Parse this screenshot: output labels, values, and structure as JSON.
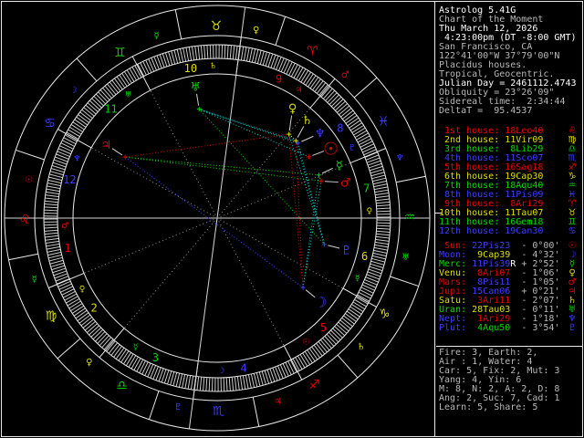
{
  "app": {
    "title": "Astrolog 5.41G"
  },
  "palette": {
    "red": "#e00000",
    "yellow": "#dede00",
    "green": "#00d400",
    "blue": "#3c3cff",
    "cyan": "#00d4d4",
    "gray": "#b8b8b8",
    "white": "#ffffff",
    "dim_gray": "#8f8f8f",
    "line_white": "#e9e9e9",
    "axis_gray": "#d6d6d6",
    "tick_gray": "#c9c9c9",
    "pointer_gray": "#cfcfcf"
  },
  "sidebar": {
    "header": [
      {
        "text": "Astrolog 5.41G",
        "bright": true
      },
      {
        "text": "Chart of the Moment",
        "bright": false
      },
      {
        "text": "Thu March 12, 2026",
        "bright": true
      },
      {
        "text": " 4:23:00pm (DT -8:00 GMT)",
        "bright": true
      },
      {
        "text": "San Francisco, CA",
        "bright": false
      },
      {
        "text": "122°41'00\"W 37°79'00\"N",
        "bright": false
      },
      {
        "text": "Placidus houses.",
        "bright": false
      },
      {
        "text": "Tropical, Geocentric.",
        "bright": false
      },
      {
        "text": "Julian Day = 2461112.4743",
        "bright": true
      },
      {
        "text": "Obliquity = 23°26'09\"",
        "bright": false
      },
      {
        "text": "Sidereal time:  2:34:44",
        "bright": false
      },
      {
        "text": "DeltaT =  95.4537",
        "bright": false
      }
    ],
    "houses": [
      {
        "ord": "1st",
        "pos": "18Leo40",
        "sign": "Leo"
      },
      {
        "ord": "2nd",
        "pos": "11Vir09",
        "sign": "Virgo"
      },
      {
        "ord": "3rd",
        "pos": "8Lib29",
        "sign": "Libra"
      },
      {
        "ord": "4th",
        "pos": "11Sco07",
        "sign": "Scorpio"
      },
      {
        "ord": "5th",
        "pos": "16Sag18",
        "sign": "Sagittarius"
      },
      {
        "ord": "6th",
        "pos": "19Cap30",
        "sign": "Capricorn"
      },
      {
        "ord": "7th",
        "pos": "18Aqu40",
        "sign": "Aquarius"
      },
      {
        "ord": "8th",
        "pos": "11Pis09",
        "sign": "Pisces"
      },
      {
        "ord": "9th",
        "pos": "8Ari29",
        "sign": "Aries"
      },
      {
        "ord": "10th",
        "pos": "11Tau07",
        "sign": "Taurus"
      },
      {
        "ord": "11th",
        "pos": "16Gem18",
        "sign": "Gemini"
      },
      {
        "ord": "12th",
        "pos": "19Can30",
        "sign": "Cancer"
      }
    ],
    "planets": [
      {
        "name": "Sun",
        "pos": "22Pis23",
        "retro": false,
        "vel": "- 0°00'"
      },
      {
        "name": "Moon",
        "pos": "9Cap39",
        "retro": false,
        "vel": "- 4°32'"
      },
      {
        "name": "Merc",
        "pos": "11Pis39",
        "retro": true,
        "vel": "+ 2°52'"
      },
      {
        "name": "Venu",
        "pos": "8Ari07",
        "retro": false,
        "vel": "- 1°06'"
      },
      {
        "name": "Mars",
        "pos": "8Pis11",
        "retro": false,
        "vel": "- 1°05'"
      },
      {
        "name": "Jupi",
        "pos": "15Can06",
        "retro": false,
        "vel": "+ 0°21'"
      },
      {
        "name": "Satu",
        "pos": "3Ari11",
        "retro": false,
        "vel": "- 2°07'"
      },
      {
        "name": "Uran",
        "pos": "28Tau03",
        "retro": false,
        "vel": "- 0°11'"
      },
      {
        "name": "Nept",
        "pos": "1Ari29",
        "retro": false,
        "vel": "- 1°18'"
      },
      {
        "name": "Plut",
        "pos": "4Aqu50",
        "retro": false,
        "vel": "- 3°54'"
      }
    ],
    "stats": [
      "Fire: 3, Earth: 2,",
      "Air : 1, Water: 4",
      "Car: 5, Fix: 2, Mut: 3",
      "Yang: 4, Yin: 6",
      "M: 8, N: 2, A: 2, D: 8",
      "Ang: 2, Suc: 7, Cad: 1",
      "Learn: 5, Share: 5"
    ]
  },
  "chart_data": {
    "type": "astrology_wheel",
    "title": "Chart of the Moment",
    "center": [
      238,
      239
    ],
    "radii": {
      "outer": 233,
      "sign_inner": 200,
      "band_outer": 190,
      "band_inner": 175,
      "house_inner": 158,
      "house_text": 167,
      "planet_glyph": 146,
      "planet_dot": 121,
      "sign_glyph": 211
    },
    "rotation_note": "ascendant 18Leo40 on left; screen angle = longitude + 41.333 deg CCW",
    "sign_names": [
      "Aries",
      "Taurus",
      "Gemini",
      "Cancer",
      "Leo",
      "Virgo",
      "Libra",
      "Scorpio",
      "Sagittarius",
      "Capricorn",
      "Aquarius",
      "Pisces"
    ],
    "sign_glyphs": [
      "♈",
      "♉",
      "♊",
      "♋",
      "♌",
      "♍",
      "♎",
      "♏",
      "♐",
      "♑",
      "♒",
      "♓"
    ],
    "planet_names": [
      "sun",
      "moon",
      "mercury",
      "venus",
      "mars",
      "jupiter",
      "saturn",
      "uranus",
      "neptune",
      "pluto"
    ],
    "planet_glyphs": [
      "☉",
      "☽",
      "☿",
      "♀",
      "♂",
      "♃",
      "♄",
      "♅",
      "♆",
      "♇"
    ],
    "planet_colors": [
      "red",
      "blue",
      "green",
      "yellow",
      "red",
      "red",
      "yellow",
      "green",
      "blue",
      "blue"
    ],
    "element_colors": [
      "red",
      "yellow",
      "green",
      "blue"
    ],
    "sign_rulers": [
      4,
      3,
      2,
      1,
      0,
      2,
      3,
      9,
      5,
      6,
      7,
      8
    ],
    "house_natural_rulers": [
      4,
      3,
      2,
      1,
      0,
      2,
      3,
      9,
      5,
      6,
      7,
      8
    ],
    "house_cusps_deg": [
      138.667,
      161.15,
      188.483,
      221.117,
      256.3,
      289.5,
      318.667,
      341.15,
      8.483,
      41.117,
      76.3,
      109.5
    ],
    "planets_deg": [
      352.383,
      279.65,
      341.65,
      8.117,
      338.183,
      105.1,
      3.183,
      58.05,
      1.483,
      304.833
    ],
    "planets_retro": [
      false,
      false,
      true,
      false,
      false,
      false,
      false,
      false,
      false,
      false
    ],
    "aspect_colors": {
      "conjunction": "yellow",
      "sextile": "cyan",
      "square": "red",
      "trine": "green",
      "opposition": "blue"
    },
    "aspects": [
      [
        1,
        2,
        "sextile"
      ],
      [
        1,
        3,
        "square"
      ],
      [
        1,
        4,
        "sextile"
      ],
      [
        1,
        5,
        "opposition"
      ],
      [
        1,
        6,
        "square"
      ],
      [
        2,
        4,
        "conjunction"
      ],
      [
        2,
        5,
        "trine"
      ],
      [
        3,
        5,
        "square"
      ],
      [
        3,
        6,
        "conjunction"
      ],
      [
        3,
        8,
        "conjunction"
      ],
      [
        3,
        9,
        "sextile"
      ],
      [
        4,
        5,
        "trine"
      ],
      [
        0,
        7,
        "sextile"
      ],
      [
        6,
        7,
        "sextile"
      ],
      [
        6,
        8,
        "conjunction"
      ],
      [
        6,
        9,
        "sextile"
      ],
      [
        7,
        8,
        "sextile"
      ],
      [
        7,
        9,
        "trine"
      ],
      [
        8,
        9,
        "sextile"
      ]
    ]
  }
}
